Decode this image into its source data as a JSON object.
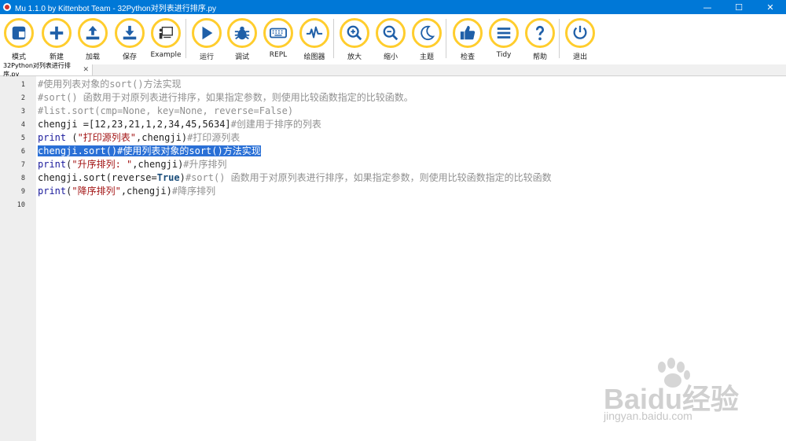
{
  "window": {
    "title": "Mu 1.1.0 by Kittenbot Team - 32Python对列表进行排序.py",
    "controls": [
      "minimize",
      "maximize",
      "close"
    ]
  },
  "toolbar": {
    "accent": "#ffcd2d",
    "buttons": [
      {
        "id": "mode",
        "label": "模式",
        "icon": "mode-icon"
      },
      {
        "id": "new",
        "label": "新建",
        "icon": "plus-icon"
      },
      {
        "id": "load",
        "label": "加载",
        "icon": "upload-icon"
      },
      {
        "id": "save",
        "label": "保存",
        "icon": "download-icon"
      },
      {
        "id": "example",
        "label": "Example",
        "icon": "presentation-icon"
      },
      {
        "id": "run",
        "label": "运行",
        "icon": "play-icon"
      },
      {
        "id": "debug",
        "label": "调试",
        "icon": "bug-icon"
      },
      {
        "id": "repl",
        "label": "REPL",
        "icon": "keyboard-icon"
      },
      {
        "id": "plotter",
        "label": "绘图器",
        "icon": "pulse-icon"
      },
      {
        "id": "zoom-in",
        "label": "放大",
        "icon": "zoom-in-icon"
      },
      {
        "id": "zoom-out",
        "label": "缩小",
        "icon": "zoom-out-icon"
      },
      {
        "id": "theme",
        "label": "主题",
        "icon": "moon-icon"
      },
      {
        "id": "check",
        "label": "检查",
        "icon": "thumbs-up-icon"
      },
      {
        "id": "tidy",
        "label": "Tidy",
        "icon": "lines-icon"
      },
      {
        "id": "help",
        "label": "帮助",
        "icon": "question-icon"
      },
      {
        "id": "quit",
        "label": "退出",
        "icon": "power-icon"
      }
    ]
  },
  "tab": {
    "label": "32Python对列表进行排序.py",
    "close": "✕"
  },
  "editor": {
    "line_numbers": [
      "1",
      "2",
      "3",
      "4",
      "5",
      "6",
      "7",
      "8",
      "9",
      "10"
    ],
    "selected_line": 6,
    "selection_color": "#2a70d6",
    "lines": [
      [
        {
          "t": "com",
          "s": "#使用列表对象的sort()方法实现"
        }
      ],
      [
        {
          "t": "com",
          "s": "#sort() 函数用于对原列表进行排序，如果指定参数，则使用比较函数指定的比较函数。"
        }
      ],
      [
        {
          "t": "com",
          "s": "#list.sort(cmp=None, key=None, reverse=False)"
        }
      ],
      [
        {
          "t": "txt",
          "s": "chengji =[12,23,21,1,2,34,45,5634]"
        },
        {
          "t": "com",
          "s": "#创建用于排序的列表"
        }
      ],
      [
        {
          "t": "kw",
          "s": "print"
        },
        {
          "t": "txt",
          "s": " ("
        },
        {
          "t": "str",
          "s": "\"打印源列表\""
        },
        {
          "t": "txt",
          "s": ",chengji)"
        },
        {
          "t": "com",
          "s": "#打印源列表"
        }
      ],
      [
        {
          "t": "sel",
          "s": "chengji.sort()#使用列表对象的sort()方法实现"
        }
      ],
      [
        {
          "t": "kw",
          "s": "print"
        },
        {
          "t": "txt",
          "s": "("
        },
        {
          "t": "str",
          "s": "\"升序排列: \""
        },
        {
          "t": "txt",
          "s": ",chengji)"
        },
        {
          "t": "com",
          "s": "#升序排列"
        }
      ],
      [
        {
          "t": "txt",
          "s": "chengji.sort(reverse="
        },
        {
          "t": "bold",
          "s": "True"
        },
        {
          "t": "txt",
          "s": ")"
        },
        {
          "t": "com",
          "s": "#sort() 函数用于对原列表进行排序，如果指定参数，则使用比较函数指定的比较函数"
        }
      ],
      [
        {
          "t": "kw",
          "s": "print"
        },
        {
          "t": "txt",
          "s": "("
        },
        {
          "t": "str",
          "s": "\"降序排列\""
        },
        {
          "t": "txt",
          "s": ",chengji)"
        },
        {
          "t": "com",
          "s": "#降序排列"
        }
      ],
      []
    ]
  },
  "watermark": {
    "brand": "Baidu经验",
    "url": "jingyan.baidu.com"
  }
}
